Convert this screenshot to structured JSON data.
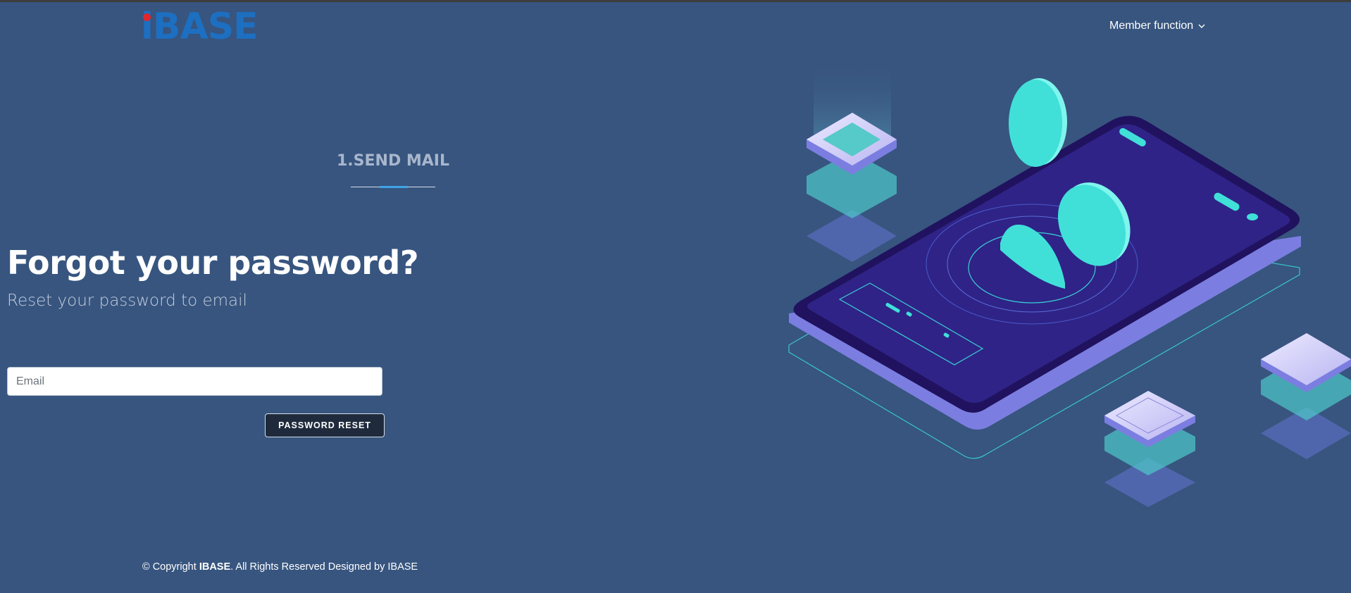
{
  "header": {
    "logo_text": "iBASE",
    "member_menu_label": "Member function",
    "member_menu_icon": "chevron-down-icon"
  },
  "colors": {
    "background": "#37557f",
    "logo_blue": "#1d6fc1",
    "logo_dot_red": "#e2262e",
    "accent_line": "#3fa3e6",
    "button_bg": "#1f2b3d",
    "illustration_cyan": "#40e0d8",
    "illustration_phone": "#2a1f7a"
  },
  "step": {
    "label": "1.SEND MAIL"
  },
  "form": {
    "title": "Forgot your password?",
    "subtitle": "Reset your password to email",
    "email_placeholder": "Email",
    "email_value": "",
    "submit_label": "PASSWORD RESET"
  },
  "footer": {
    "prefix": "© Copyright ",
    "brand": "IBASE",
    "suffix": ". All Rights Reserved Designed by IBASE"
  }
}
